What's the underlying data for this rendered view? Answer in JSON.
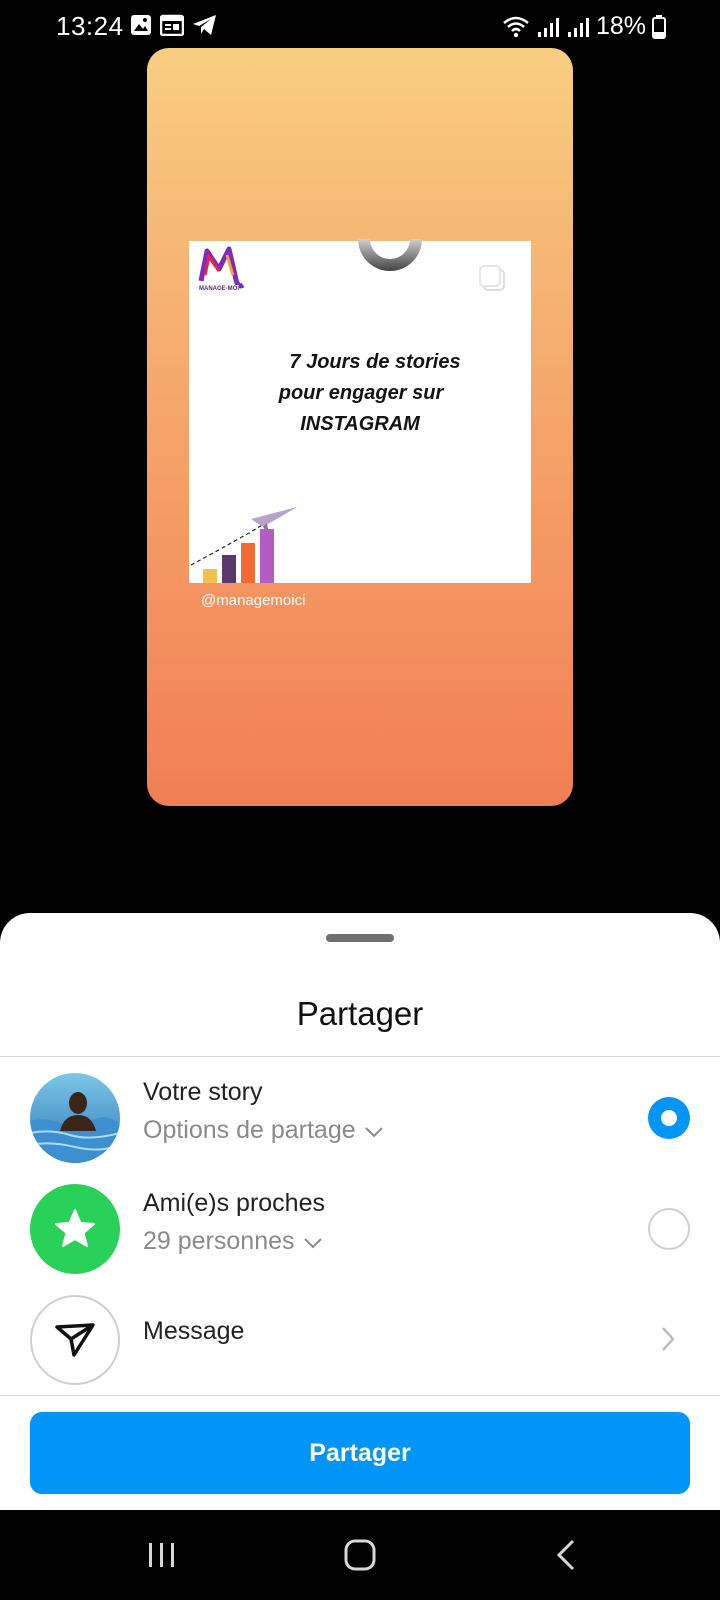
{
  "status_bar": {
    "time": "13:24",
    "battery": "18%",
    "icons": [
      "image-icon",
      "calendar-icon",
      "telegram-icon",
      "wifi-icon",
      "signal-icon",
      "signal-icon",
      "battery-icon"
    ]
  },
  "story_preview": {
    "post_headline": {
      "line1": "7 Jours de stories",
      "line2": "pour engager sur",
      "line3": "INSTAGRAM"
    },
    "logo_text": "MANAGE-MOI",
    "handle": "@managemoici",
    "gradient": {
      "top": "#f8cd82",
      "bottom": "#f27e55"
    }
  },
  "sheet": {
    "title": "Partager",
    "options": [
      {
        "title": "Votre story",
        "subtitle": "Options de partage",
        "selected": true
      },
      {
        "title": "Ami(e)s proches",
        "subtitle": "29 personnes",
        "selected": false
      },
      {
        "title": "Message"
      }
    ],
    "share_button": "Partager"
  },
  "colors": {
    "accent": "#0095f6",
    "close_friends": "#2ad159"
  },
  "navbar": {
    "icons": [
      "recent-apps-icon",
      "home-icon",
      "back-icon"
    ]
  }
}
